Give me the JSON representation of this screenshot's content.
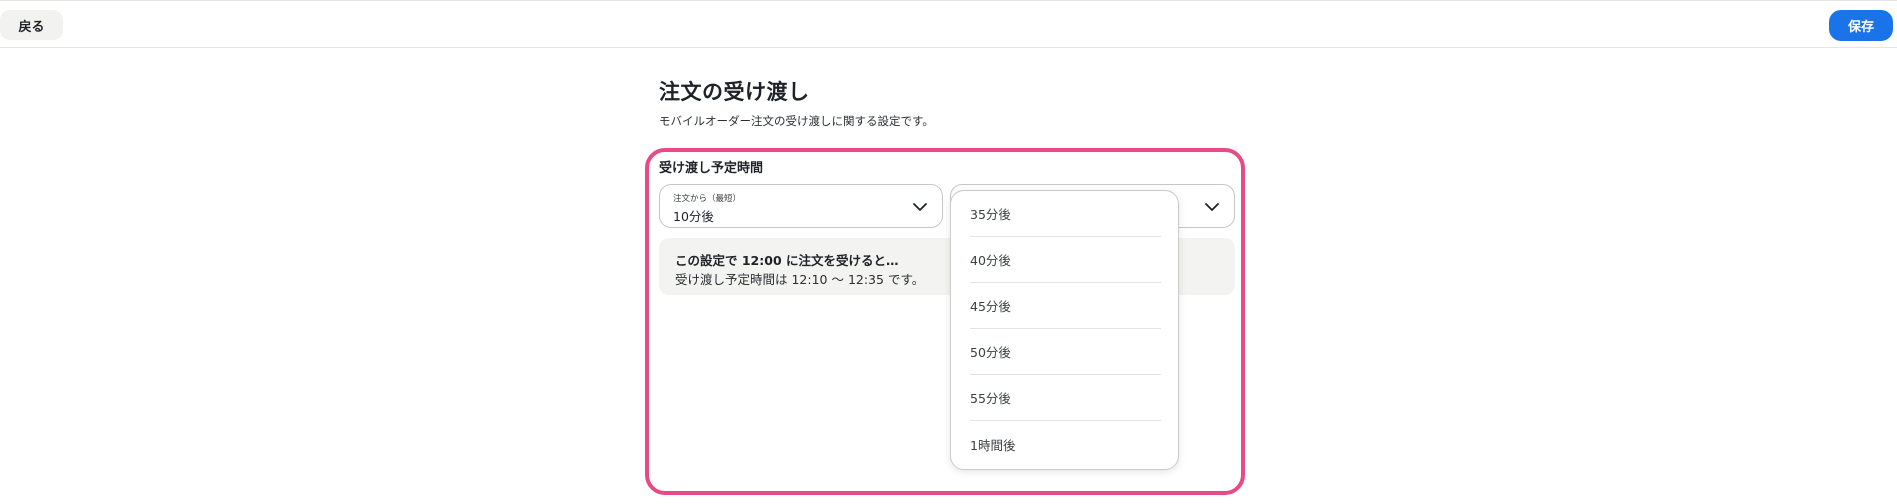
{
  "toolbar": {
    "back_label": "戻る",
    "save_label": "保存"
  },
  "page": {
    "title": "注文の受け渡し",
    "description": "モバイルオーダー注文の受け渡しに関する設定です。"
  },
  "section": {
    "label": "受け渡し予定時間"
  },
  "min_select": {
    "caption": "注文から（最短）",
    "value": "10分後"
  },
  "max_select": {
    "caption": "",
    "value": ""
  },
  "info": {
    "title": "この設定で 12:00 に注文を受けると…",
    "body": "受け渡し予定時間は 12:10 〜 12:35 です。"
  },
  "dropdown": {
    "options": [
      "35分後",
      "40分後",
      "45分後",
      "50分後",
      "55分後",
      "1時間後"
    ]
  },
  "colors": {
    "accent": "#1a73e8",
    "highlight": "#e84a86"
  },
  "icons": {
    "select_chevron": "chevron-down-icon"
  }
}
